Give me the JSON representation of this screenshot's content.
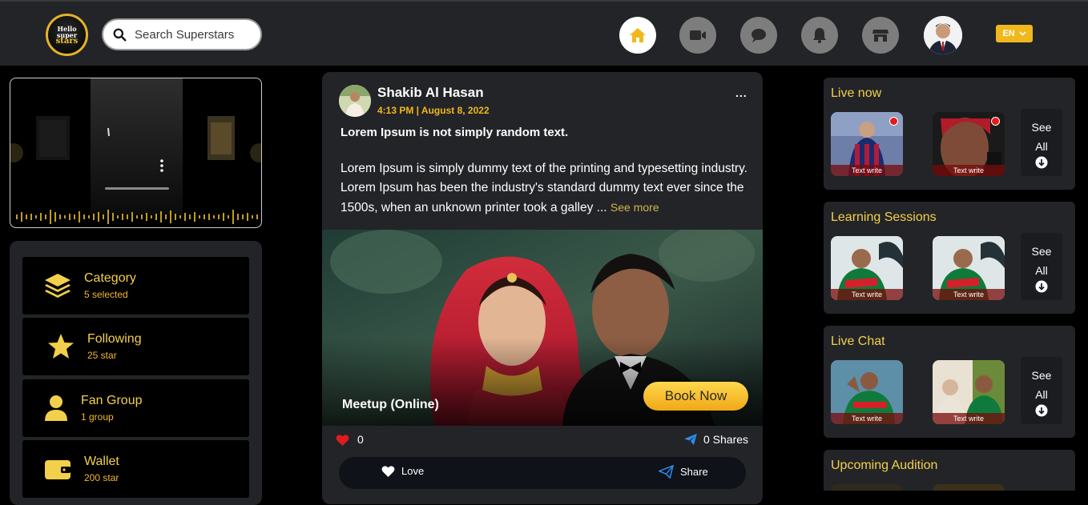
{
  "header": {
    "logo_line1": "Hello",
    "logo_line2": "super",
    "logo_line3": "stars",
    "search_placeholder": "Search Superstars",
    "lang": "EN"
  },
  "sidebar": {
    "items": [
      {
        "title": "Category",
        "sub": "5 selected",
        "icon": "layers-icon"
      },
      {
        "title": "Following",
        "sub": "25 star",
        "icon": "star-icon"
      },
      {
        "title": "Fan Group",
        "sub": "1 group",
        "icon": "user-icon"
      },
      {
        "title": "Wallet",
        "sub": "200 star",
        "icon": "wallet-icon"
      }
    ]
  },
  "post": {
    "author": "Shakib Al Hasan",
    "date": "4:13 PM | August 8, 2022",
    "more": "...",
    "title": "Lorem Ipsum is not simply random text.",
    "body": "Lorem Ipsum is simply dummy text of the printing and typesetting industry. Lorem Ipsum has been the industry's standard dummy text ever since the 1500s, when an unknown printer took a galley ...",
    "see_more": "See more",
    "image_caption": "Meetup (Online)",
    "book_label": "Book Now",
    "likes": "0",
    "shares": "0 Shares",
    "love_label": "Love",
    "share_label": "Share"
  },
  "right": {
    "live_now": {
      "title": "Live now",
      "thumbs": [
        "Text write",
        "Text write"
      ],
      "see": "See",
      "all": "All"
    },
    "learning": {
      "title": "Learning Sessions",
      "thumbs": [
        "Text write",
        "Text write"
      ],
      "see": "See",
      "all": "All"
    },
    "live_chat": {
      "title": "Live Chat",
      "thumbs": [
        "Text write",
        "Text write"
      ],
      "see": "See",
      "all": "All"
    },
    "audition": {
      "title": "Upcoming Audition"
    }
  },
  "colors": {
    "accent": "#f0b81c",
    "panel": "#232427",
    "gold_text": "#f3d04b"
  }
}
